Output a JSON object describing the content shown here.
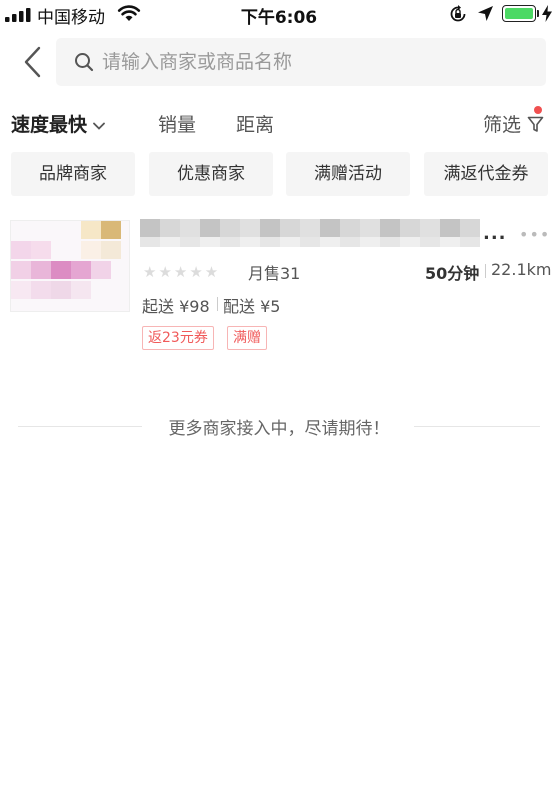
{
  "status_bar": {
    "carrier": "中国移动",
    "time": "下午6:06",
    "battery_color": "#4cd964"
  },
  "search": {
    "placeholder": "请输入商家或商品名称",
    "value": ""
  },
  "sort_bar": {
    "active": "速度最快",
    "sales": "销量",
    "distance": "距离",
    "filter": "筛选",
    "filter_dot_color": "#f05050"
  },
  "tags": [
    "品牌商家",
    "优惠商家",
    "满赠活动",
    "满返代金券"
  ],
  "merchant": {
    "name_ellipsis": "...",
    "rating_stars": "★★★★★",
    "rating_value": 0,
    "monthly_sales": "月售31",
    "delivery_time": "50分钟",
    "distance": "22.1km",
    "min_order": "起送 ¥98",
    "delivery_fee": "配送 ¥5",
    "promos": [
      "返23元券",
      "满赠"
    ]
  },
  "footer": {
    "text": "更多商家接入中，尽请期待！"
  },
  "colors": {
    "promo_red": "#f05a5a",
    "tag_bg": "#f5f5f5",
    "search_bg": "#f5f5f5"
  }
}
